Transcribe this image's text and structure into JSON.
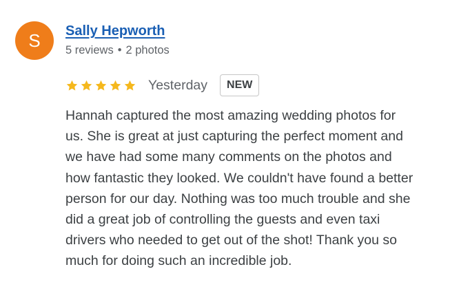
{
  "reviewer": {
    "initial": "S",
    "avatar_color": "#ef7d1a",
    "name": "Sally Hepworth",
    "name_color": "#1a5fb4",
    "reviews": "5 reviews",
    "separator": "•",
    "photos": "2 photos"
  },
  "rating": {
    "stars": 5,
    "max_stars": 5,
    "star_color": "#f5b81d",
    "star_icon": "star-icon",
    "date": "Yesterday",
    "badge": "NEW"
  },
  "review_text": [
    "Hannah captured the most amazing wedding photos for",
    "us. She is great at just capturing the perfect moment and",
    "we have had some many comments on the photos and",
    "how fantastic they looked. We couldn't have found a better",
    "person for our day. Nothing was too much trouble and she",
    "did a great job of controlling the guests and even taxi",
    "drivers who needed to get out of the shot! Thank you so",
    "much for doing such an incredible job."
  ]
}
